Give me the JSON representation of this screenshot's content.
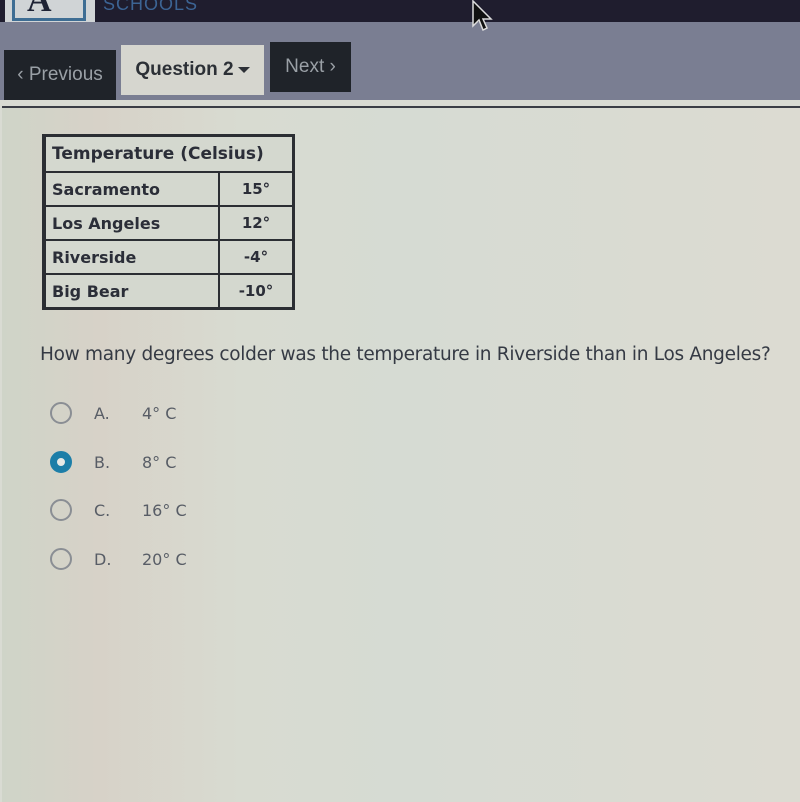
{
  "header": {
    "logo_letter": "A",
    "brand_text": "SCHOOLS"
  },
  "nav": {
    "previous_label": "‹ Previous",
    "question_label": "Question 2",
    "next_label": "Next ›"
  },
  "table": {
    "header": "Temperature (Celsius)",
    "rows": [
      {
        "city": "Sacramento",
        "value": "15°"
      },
      {
        "city": "Los Angeles",
        "value": "12°"
      },
      {
        "city": "Riverside",
        "value": "-4°"
      },
      {
        "city": "Big Bear",
        "value": "-10°"
      }
    ]
  },
  "question": {
    "text": "How many degrees colder was the temperature in Riverside than in Los Angeles?",
    "options": [
      {
        "letter": "A.",
        "text": "4° C",
        "selected": false
      },
      {
        "letter": "B.",
        "text": "8° C",
        "selected": true
      },
      {
        "letter": "C.",
        "text": "16° C",
        "selected": false
      },
      {
        "letter": "D.",
        "text": "20° C",
        "selected": false
      }
    ]
  },
  "colors": {
    "accent": "#1c7ea8",
    "nav_dark": "#1f2329",
    "topbar": "#1f1d2e"
  }
}
